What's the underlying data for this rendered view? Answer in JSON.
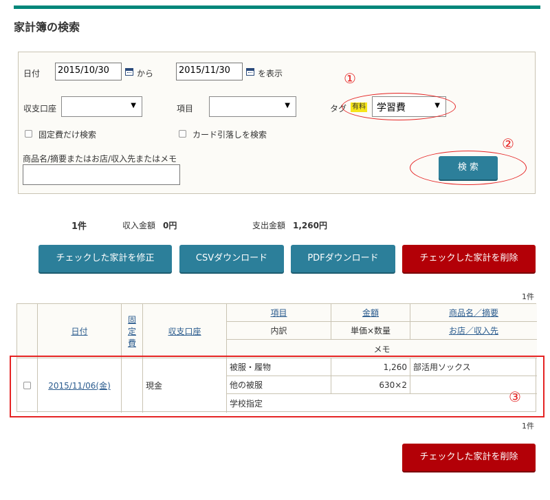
{
  "page": {
    "title": "家計簿の検索"
  },
  "search": {
    "date_label": "日付",
    "date_from": "2015/10/30",
    "from_label": "から",
    "date_to": "2015/11/30",
    "to_label": "を表示",
    "account_label": "収支口座",
    "account_value": "",
    "item_label": "項目",
    "item_value": "",
    "tag_label": "タグ",
    "tag_badge": "有料",
    "tag_value": "学習費",
    "fixed_cost_label": "固定費だけ検索",
    "card_label": "カード引落しを検索",
    "keyword_label": "商品名/摘要またはお店/収入先またはメモ",
    "keyword_value": "",
    "search_button": "検 索"
  },
  "annotations": {
    "one": "①",
    "two": "②",
    "three": "③"
  },
  "summary": {
    "count": "1件",
    "income_label": "収入金額",
    "income_value": "0円",
    "expense_label": "支出金額",
    "expense_value": "1,260円"
  },
  "actions": {
    "edit_checked": "チェックした家計を修正",
    "csv_download": "CSVダウンロード",
    "pdf_download": "PDFダウンロード",
    "delete_checked": "チェックした家計を削除"
  },
  "table": {
    "count_top": "1件",
    "count_bottom": "1件",
    "headers": {
      "date": "日付",
      "fixed_1": "固",
      "fixed_2": "定",
      "fixed_3": "費",
      "account": "収支口座",
      "item": "項目",
      "amount": "金額",
      "product": "商品名／摘要",
      "breakdown": "内訳",
      "unit_qty": "単価×数量",
      "shop": "お店／収入先",
      "memo": "メモ"
    },
    "row": {
      "date": "2015/11/06(金)",
      "account": "現金",
      "item": "被服・履物",
      "amount": "1,260",
      "product": "部活用ソックス",
      "breakdown": "他の被服",
      "unit_qty": "630×2",
      "shop": "",
      "memo": "学校指定"
    }
  },
  "colors": {
    "accent": "#00877a",
    "button_blue": "#2c7f9a",
    "button_red": "#b30007",
    "annotation": "#e52222",
    "badge": "#f6e51a"
  }
}
